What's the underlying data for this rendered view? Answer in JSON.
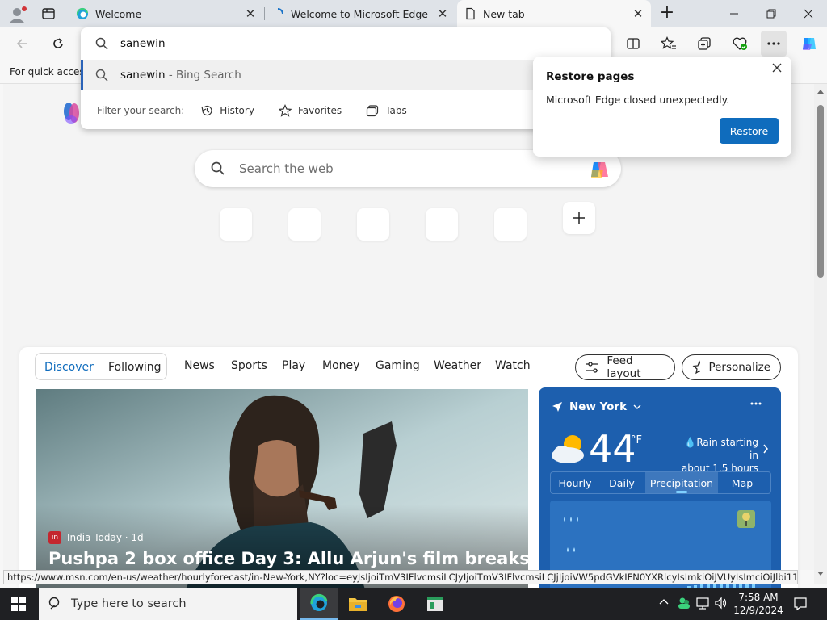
{
  "tabs": [
    {
      "label": "Welcome",
      "icon": "edge-logo-icon",
      "active": false
    },
    {
      "label": "Welcome to Microsoft Edge",
      "icon": "loading-spinner-icon",
      "active": false
    },
    {
      "label": "New tab",
      "icon": "page-icon",
      "active": true
    }
  ],
  "favorites_bar": {
    "text": "For quick access"
  },
  "omnibox": {
    "value": "sanewin",
    "suggestion": {
      "query": "sanewin",
      "source": " - Bing Search"
    },
    "filter_label": "Filter your search:",
    "filters": [
      "History",
      "Favorites",
      "Tabs"
    ]
  },
  "restore_popup": {
    "title": "Restore pages",
    "message": "Microsoft Edge closed unexpectedly.",
    "button": "Restore"
  },
  "search": {
    "placeholder": "Search the web"
  },
  "feed": {
    "toggle": [
      "Discover",
      "Following"
    ],
    "nav": [
      "News",
      "Sports",
      "Play",
      "Money",
      "Gaming",
      "Weather",
      "Watch"
    ],
    "feed_layout": "Feed layout",
    "personalize": "Personalize"
  },
  "hero": {
    "source": "India Today",
    "age": " · 1d",
    "headline": "Pushpa 2 box office Day 3: Allu Arjun's film breaks"
  },
  "weather": {
    "location": "New York",
    "temp": "44",
    "unit": "°F",
    "forecast_line1": "Rain starting in",
    "forecast_line2": "about 1.5 hours",
    "tabs": [
      "Hourly",
      "Daily",
      "Precipitation",
      "Map"
    ],
    "selected_tab": "Precipitation"
  },
  "status_url": "https://www.msn.com/en-us/weather/hourlyforecast/in-New-York,NY?loc=eyJsIjoiTmV3IFlvcmsiLCJyIjoiTmV3IFlvcmsiLCJjIjoiVW5pdGVkIFN0YXRlcyIsImkiOiJVUyIsImciOiJlbi11cyIsIngiOi...",
  "taskbar": {
    "search_placeholder": "Type here to search",
    "time": "7:58 AM",
    "date": "12/9/2024"
  },
  "colors": {
    "accent": "#0f6cbd",
    "weather_bg": "#1d5fae",
    "taskbar": "#1f2023"
  }
}
